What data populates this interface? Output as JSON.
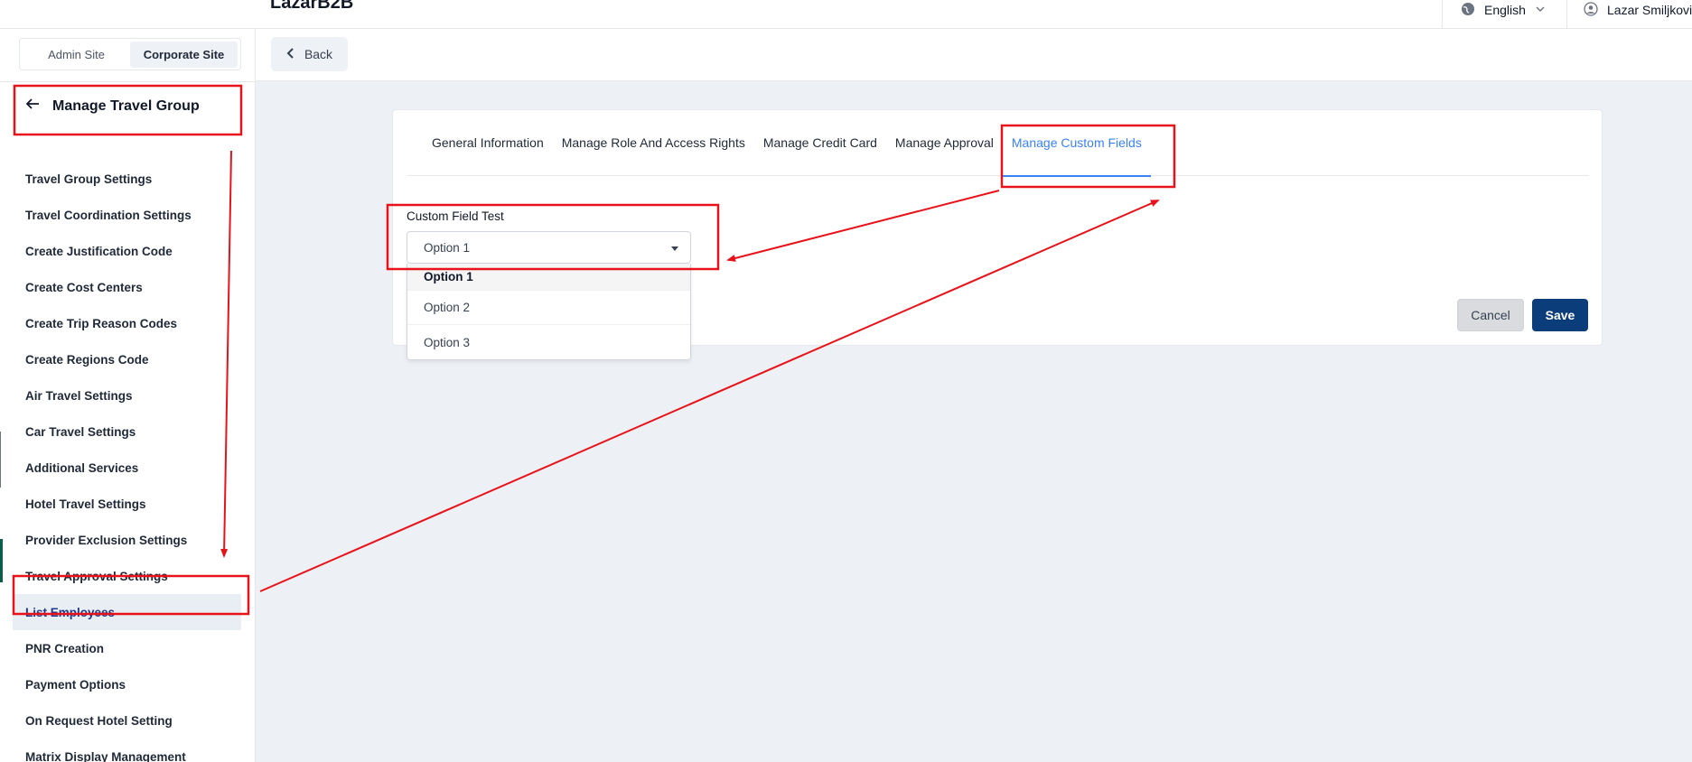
{
  "header": {
    "app_title": "LazarB2B",
    "language": "English",
    "user_name": "Lazar Smiljkovic"
  },
  "subbar": {
    "back_label": "Back"
  },
  "sidebar": {
    "site_toggle": [
      "Admin Site",
      "Corporate Site"
    ],
    "active_site": "Corporate Site",
    "section_title": "Manage Travel Group",
    "items": [
      {
        "label": "Travel Group Settings"
      },
      {
        "label": "Travel Coordination Settings"
      },
      {
        "label": "Create Justification Code"
      },
      {
        "label": "Create Cost Centers"
      },
      {
        "label": "Create Trip Reason Codes"
      },
      {
        "label": "Create Regions Code"
      },
      {
        "label": "Air Travel Settings"
      },
      {
        "label": "Car Travel Settings"
      },
      {
        "label": "Additional Services"
      },
      {
        "label": "Hotel Travel Settings"
      },
      {
        "label": "Provider Exclusion Settings"
      },
      {
        "label": "Travel Approval Settings"
      },
      {
        "label": "List Employees",
        "active": true
      },
      {
        "label": "PNR Creation"
      },
      {
        "label": "Payment Options"
      },
      {
        "label": "On Request Hotel Setting"
      },
      {
        "label": "Matrix Display Management"
      }
    ]
  },
  "main": {
    "tabs": [
      {
        "label": "General Information"
      },
      {
        "label": "Manage Role And Access Rights"
      },
      {
        "label": "Manage Credit Card"
      },
      {
        "label": "Manage Approval"
      },
      {
        "label": "Manage Custom Fields",
        "active": true
      }
    ],
    "custom_field": {
      "label": "Custom Field Test",
      "selected": "Option 1",
      "options": [
        "Option 1",
        "Option 2",
        "Option 3"
      ]
    },
    "cancel_label": "Cancel",
    "save_label": "Save"
  },
  "colors": {
    "accent": "#3b82f6",
    "primary_button": "#0b3d7a",
    "annotation": "#e8131a",
    "active_nav_bg": "#e9eef5"
  }
}
